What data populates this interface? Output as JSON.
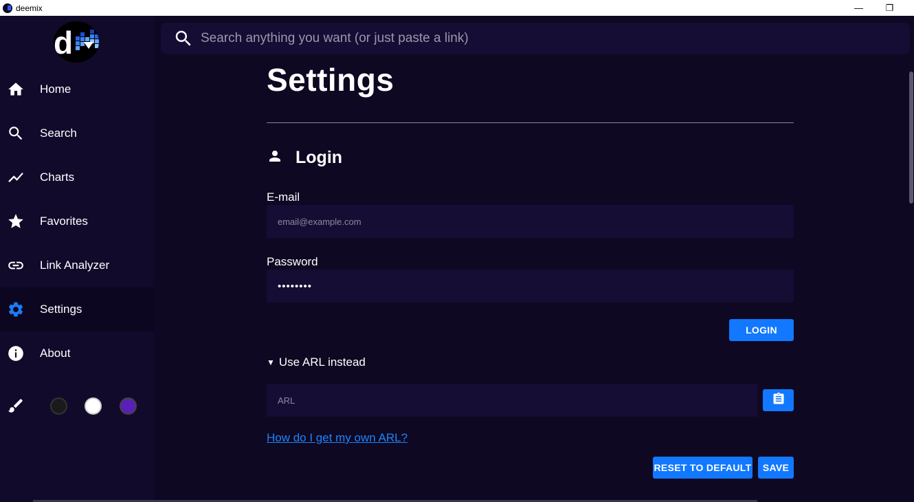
{
  "window": {
    "title": "deemix",
    "minimize_glyph": "—",
    "restore_glyph": "❐"
  },
  "logo": {
    "letter": "d"
  },
  "sidebar": {
    "items": [
      {
        "label": "Home",
        "icon": "home-icon",
        "active": false
      },
      {
        "label": "Search",
        "icon": "search-icon",
        "active": false
      },
      {
        "label": "Charts",
        "icon": "chart-line-icon",
        "active": false
      },
      {
        "label": "Favorites",
        "icon": "star-icon",
        "active": false
      },
      {
        "label": "Link Analyzer",
        "icon": "link-icon",
        "active": false
      },
      {
        "label": "Settings",
        "icon": "gear-icon",
        "active": true
      },
      {
        "label": "About",
        "icon": "info-icon",
        "active": false
      }
    ],
    "themes": {
      "icon": "paintbrush-icon",
      "swatches": [
        {
          "name": "dark",
          "color": "#1a1a1a"
        },
        {
          "name": "light",
          "color": "#ffffff"
        },
        {
          "name": "purple",
          "color": "#5a1fb8"
        }
      ]
    }
  },
  "search": {
    "placeholder": "Search anything you want (or just paste a link)",
    "value": ""
  },
  "main": {
    "title": "Settings",
    "login_section": {
      "title": "Login",
      "icon": "user-icon",
      "email_label": "E-mail",
      "email_placeholder": "email@example.com",
      "password_label": "Password",
      "password_value": "••••••••",
      "login_button": "LOGIN",
      "arl_summary": "Use ARL instead",
      "arl_placeholder": "ARL",
      "paste_icon": "clipboard-icon",
      "arl_help_link": "How do I get my own ARL?"
    },
    "footer_buttons": {
      "reset": "RESET TO DEFAULT",
      "save": "SAVE"
    }
  },
  "colors": {
    "background": "#0e0822",
    "sidebar": "#120a2b",
    "input": "#160d34",
    "accent": "#1278ff",
    "active_icon": "#1c7cf4"
  }
}
